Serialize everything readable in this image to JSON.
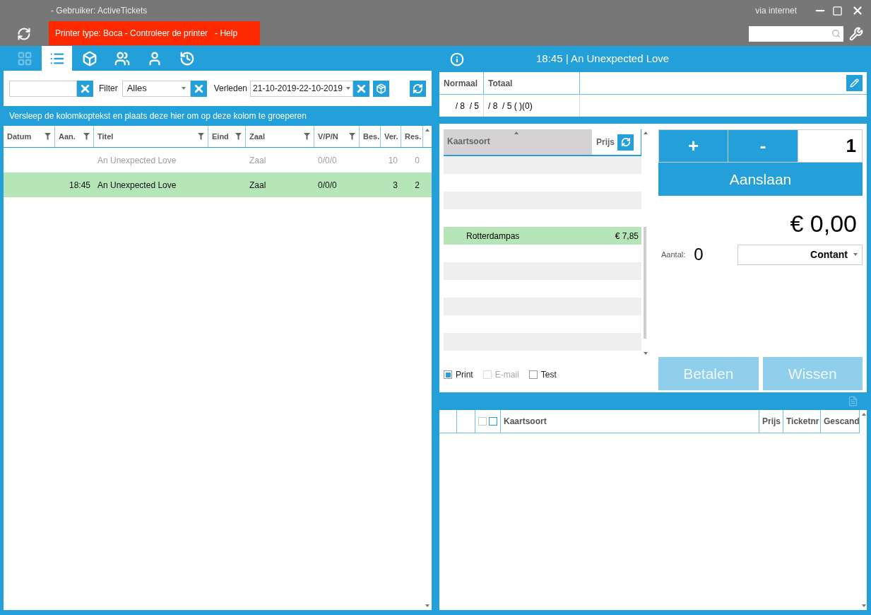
{
  "window": {
    "title": "- Gebruiker: ActiveTickets",
    "connection": "via internet"
  },
  "printer_alert": {
    "message": "Printer type: Boca - Controleer de printer",
    "link": "- Help"
  },
  "nav_tabs": [
    {
      "kind": "grid",
      "selected": false
    },
    {
      "kind": "list",
      "selected": true
    },
    {
      "kind": "box",
      "selected": false
    },
    {
      "kind": "seats",
      "selected": false
    },
    {
      "kind": "person",
      "selected": false
    },
    {
      "kind": "history",
      "selected": false
    }
  ],
  "filters": {
    "filter_label": "Filter",
    "filter_value": "Alles",
    "period_label": "Verleden",
    "period_value": "21-10-2019-22-10-2019"
  },
  "group_hint": "Versleep de kolomkoptekst en plaats deze hier om op deze kolom te groeperen",
  "events": {
    "columns": [
      {
        "label": "Datum",
        "filter": true
      },
      {
        "label": "Aan.",
        "filter": true
      },
      {
        "label": "Titel",
        "filter": true
      },
      {
        "label": "Eind",
        "filter": true
      },
      {
        "label": "Zaal",
        "filter": true
      },
      {
        "label": "V/P/N",
        "filter": true
      },
      {
        "label": "Bes."
      },
      {
        "label": "Ver."
      },
      {
        "label": "Res."
      }
    ],
    "rows": [
      {
        "selected": false,
        "dimmed": true,
        "cells": [
          "",
          "",
          "An Unexpected Love",
          "",
          "Zaal",
          "0/0/0",
          "",
          "10",
          "0"
        ]
      },
      {
        "selected": true,
        "dimmed": false,
        "cells": [
          "",
          "18:45",
          "An Unexpected Love",
          "",
          "Zaal",
          "0/0/0",
          "",
          "3",
          "2"
        ]
      }
    ]
  },
  "show": {
    "title": "18:45 | An Unexpected Love",
    "summary_columns": [
      "Normaal",
      "Totaal"
    ],
    "summary_values": [
      "/ 8  / 5",
      "/ 8  / 5 ( )(0)"
    ]
  },
  "ticket_types": {
    "columns": [
      "Kaartsoort",
      "Prijs"
    ],
    "rows": [
      {
        "kind": "redacted"
      },
      {
        "kind": "blank"
      },
      {
        "kind": "redacted"
      },
      {
        "kind": "blank"
      },
      {
        "kind": "ticket",
        "name": "Rotterdampas",
        "price": "€ 7,85",
        "selected": true
      },
      {
        "kind": "blank"
      },
      {
        "kind": "redacted"
      },
      {
        "kind": "blank"
      },
      {
        "kind": "redacted"
      },
      {
        "kind": "blank"
      },
      {
        "kind": "redacted"
      }
    ]
  },
  "options": [
    {
      "label": "Print",
      "checked": true,
      "disabled": false
    },
    {
      "label": "E-mail",
      "checked": false,
      "disabled": true
    },
    {
      "label": "Test",
      "checked": false,
      "disabled": false
    }
  ],
  "order": {
    "plus": "+",
    "minus": "-",
    "quantity": "1",
    "add_button": "Aanslaan",
    "total": "€ 0,00",
    "count_label": "Aantal:",
    "count": "0",
    "payment": "Contant",
    "pay_button": {
      "label": "Betalen",
      "disabled": true
    },
    "clear_button": {
      "label": "Wissen",
      "disabled": true
    }
  },
  "tickets_grid": {
    "header_checkboxes": [
      {
        "checked": false
      },
      {
        "checked": false
      }
    ],
    "columns": [
      "Kaartsoort",
      "Prijs",
      "Ticketnr",
      "Gescand"
    ]
  }
}
